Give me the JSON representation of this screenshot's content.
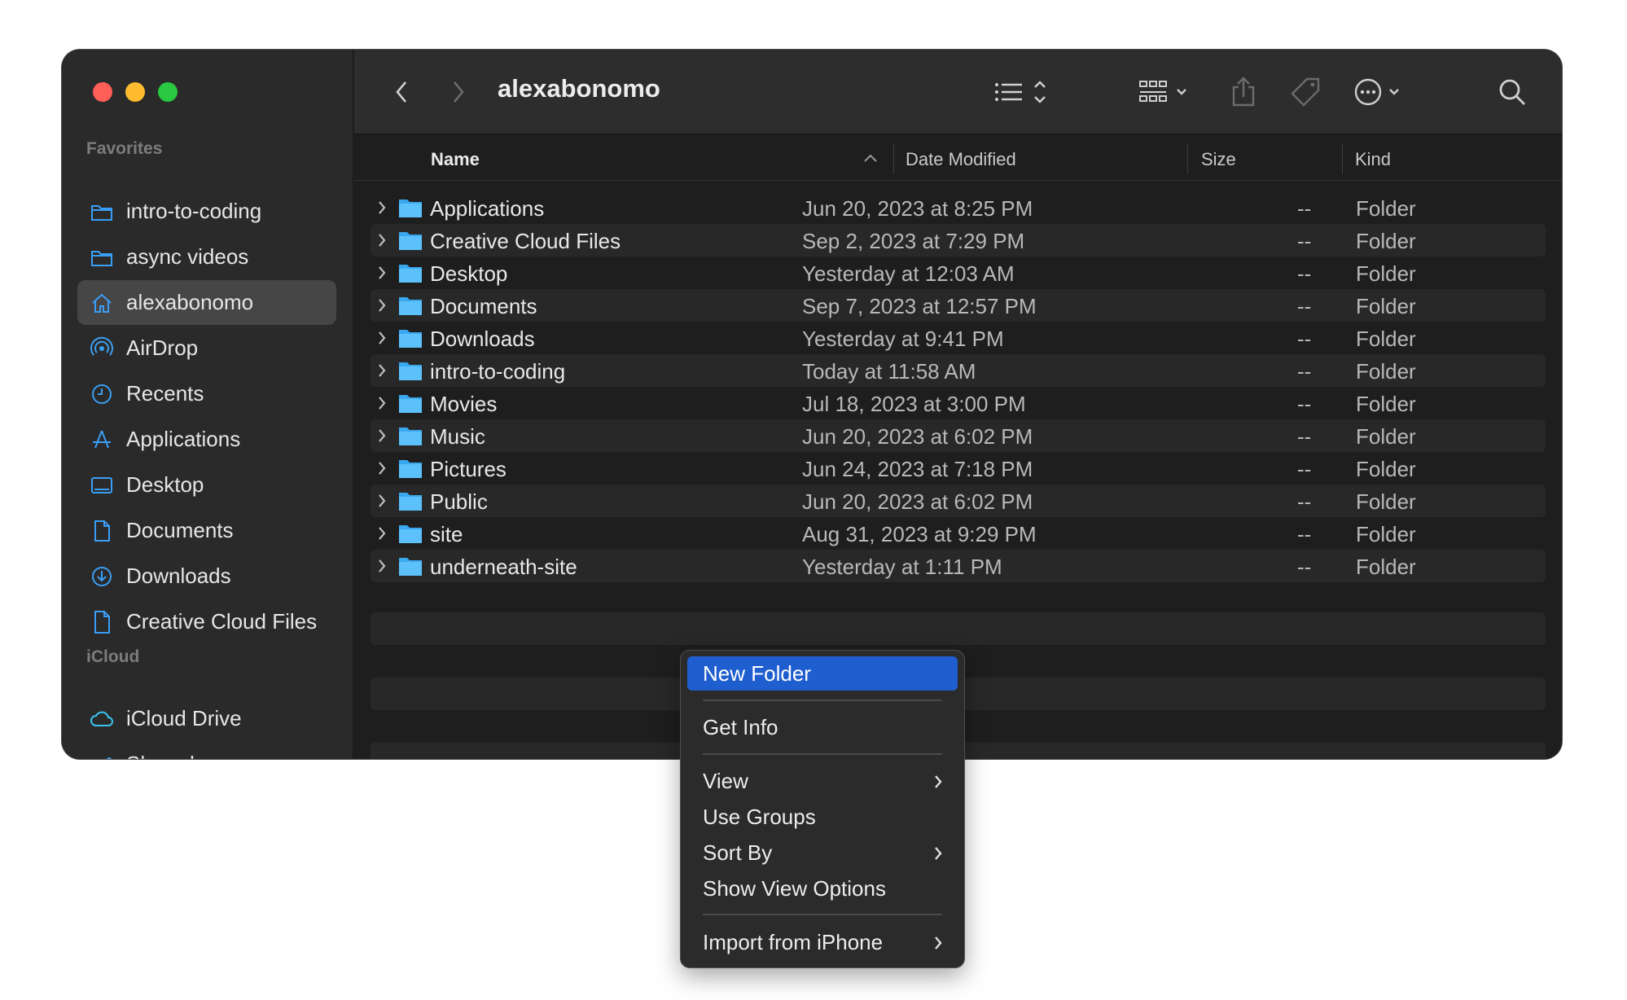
{
  "window": {
    "title": "alexabonomo"
  },
  "sidebar": {
    "favorites_label": "Favorites",
    "icloud_label": "iCloud",
    "favorites": [
      {
        "label": "intro-to-coding",
        "icon": "folder-icon"
      },
      {
        "label": "async videos",
        "icon": "folder-icon"
      },
      {
        "label": "alexabonomo",
        "icon": "home-icon",
        "selected": true
      },
      {
        "label": "AirDrop",
        "icon": "airdrop-icon"
      },
      {
        "label": "Recents",
        "icon": "clock-icon"
      },
      {
        "label": "Applications",
        "icon": "applications-icon"
      },
      {
        "label": "Desktop",
        "icon": "desktop-icon"
      },
      {
        "label": "Documents",
        "icon": "document-icon"
      },
      {
        "label": "Downloads",
        "icon": "download-icon"
      },
      {
        "label": "Creative Cloud Files",
        "icon": "file-icon"
      }
    ],
    "icloud": [
      {
        "label": "iCloud Drive",
        "icon": "cloud-icon"
      },
      {
        "label": "Shared",
        "icon": "shared-folder-icon"
      }
    ]
  },
  "columns": {
    "name": "Name",
    "date": "Date Modified",
    "size": "Size",
    "kind": "Kind"
  },
  "files": [
    {
      "name": "Applications",
      "date": "Jun 20, 2023 at 8:25 PM",
      "size": "--",
      "kind": "Folder"
    },
    {
      "name": "Creative Cloud Files",
      "date": "Sep 2, 2023 at 7:29 PM",
      "size": "--",
      "kind": "Folder"
    },
    {
      "name": "Desktop",
      "date": "Yesterday at 12:03 AM",
      "size": "--",
      "kind": "Folder"
    },
    {
      "name": "Documents",
      "date": "Sep 7, 2023 at 12:57 PM",
      "size": "--",
      "kind": "Folder"
    },
    {
      "name": "Downloads",
      "date": "Yesterday at 9:41 PM",
      "size": "--",
      "kind": "Folder"
    },
    {
      "name": "intro-to-coding",
      "date": "Today at 11:58 AM",
      "size": "--",
      "kind": "Folder"
    },
    {
      "name": "Movies",
      "date": "Jul 18, 2023 at 3:00 PM",
      "size": "--",
      "kind": "Folder"
    },
    {
      "name": "Music",
      "date": "Jun 20, 2023 at 6:02 PM",
      "size": "--",
      "kind": "Folder"
    },
    {
      "name": "Pictures",
      "date": "Jun 24, 2023 at 7:18 PM",
      "size": "--",
      "kind": "Folder"
    },
    {
      "name": "Public",
      "date": "Jun 20, 2023 at 6:02 PM",
      "size": "--",
      "kind": "Folder"
    },
    {
      "name": "site",
      "date": "Aug 31, 2023 at 9:29 PM",
      "size": "--",
      "kind": "Folder"
    },
    {
      "name": "underneath-site",
      "date": "Yesterday at 1:11 PM",
      "size": "--",
      "kind": "Folder"
    }
  ],
  "context_menu": {
    "new_folder": "New Folder",
    "get_info": "Get Info",
    "view": "View",
    "use_groups": "Use Groups",
    "sort_by": "Sort By",
    "show_view_options": "Show View Options",
    "import_from_iphone": "Import from iPhone"
  },
  "colors": {
    "accent": "#1f5ecf",
    "folder_blue": "#3aa8ef",
    "traffic_red": "#ff5f57",
    "traffic_yellow": "#febc2e",
    "traffic_green": "#28c840"
  }
}
